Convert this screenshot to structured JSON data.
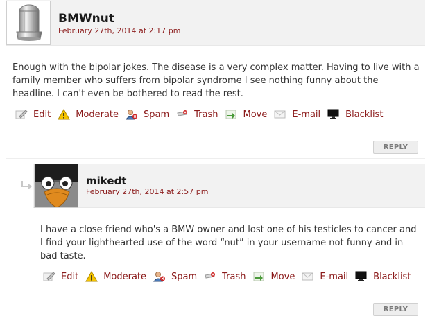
{
  "comments": [
    {
      "author": "BMWnut",
      "date": "February 27th, 2014 at 2:17 pm",
      "body": "Enough with the bipolar jokes. The disease is a very complex matter. Having to live with a family member who suffers from bipolar syndrome I see nothing funny about the headline. I can't even be bothered to read the rest.",
      "reply_label": "REPLY"
    },
    {
      "author": "mikedt",
      "date": "February 27th, 2014 at 2:57 pm",
      "body": "I have a close friend who's a BMW owner and lost one of his testicles to cancer and I find your lighthearted use of the word “nut” in your username not funny and in bad taste.",
      "reply_label": "REPLY"
    }
  ],
  "actions": {
    "edit": "Edit",
    "moderate": "Moderate",
    "spam": "Spam",
    "trash": "Trash",
    "move": "Move",
    "email": "E-mail",
    "blacklist": "Blacklist"
  },
  "colors": {
    "link": "#8b1a1a",
    "header_bg": "#f2f2f2",
    "warning": "#f5c400"
  },
  "icons": [
    "edit-icon",
    "warning-icon",
    "spam-user-icon",
    "trash-icon",
    "move-icon",
    "email-icon",
    "blacklist-monitor-icon",
    "reply-arrow-icon"
  ]
}
